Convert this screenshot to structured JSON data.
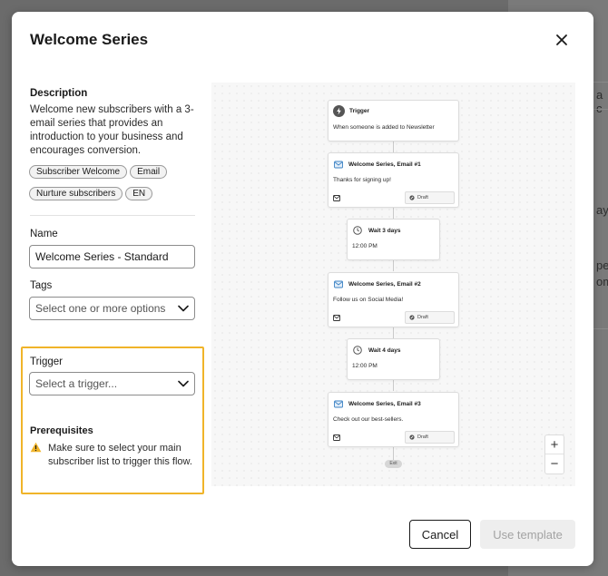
{
  "background": {
    "fragments": [
      "a c",
      "ay",
      "pe",
      "om"
    ]
  },
  "modal": {
    "title": "Welcome Series"
  },
  "description": {
    "label": "Description",
    "text": "Welcome new subscribers with a 3-email series that provides an introduction to your business and encourages conversion.",
    "tags": [
      "Subscriber Welcome",
      "Email",
      "Nurture subscribers",
      "EN"
    ]
  },
  "form": {
    "name_label": "Name",
    "name_value": "Welcome Series - Standard",
    "tags_label": "Tags",
    "tags_placeholder": "Select one or more options",
    "trigger_label": "Trigger",
    "trigger_placeholder": "Select a trigger...",
    "prereq_label": "Prerequisites",
    "prereq_text": "Make sure to select your main subscriber list to trigger this flow."
  },
  "flow": {
    "trigger": {
      "title": "Trigger",
      "text": "When someone is added to Newsletter"
    },
    "emails": [
      {
        "title": "Welcome Series, Email #1",
        "text": "Thanks for signing up!",
        "status": "Draft"
      },
      {
        "title": "Welcome Series, Email #2",
        "text": "Follow us on Social Media!",
        "status": "Draft"
      },
      {
        "title": "Welcome Series, Email #3",
        "text": "Check out our best-sellers.",
        "status": "Draft"
      }
    ],
    "waits": [
      {
        "title": "Wait 3 days",
        "time": "12:00 PM"
      },
      {
        "title": "Wait 4 days",
        "time": "12:00 PM"
      }
    ],
    "exit_label": "Exit",
    "zoom_in": "+",
    "zoom_out": "−"
  },
  "footer": {
    "cancel_label": "Cancel",
    "use_label": "Use template"
  },
  "colors": {
    "highlight_border": "#f0b429",
    "email_icon": "#3b82c4",
    "warning": "#f0b429"
  }
}
